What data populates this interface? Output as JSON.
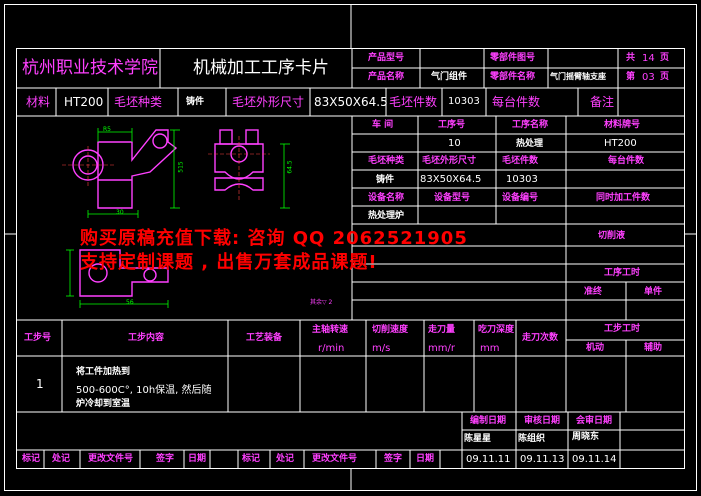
{
  "header": {
    "school": "杭州职业技术学院",
    "card_title": "机械加工工序卡片",
    "product_model_label": "产品型号",
    "product_name_label": "产品名称",
    "product_name": "气门组件",
    "part_model_label": "零部件图号",
    "part_name_label": "零部件名称",
    "part_name": "气门摇臂轴支座",
    "total_label": "共",
    "total_pages": "14",
    "page_unit": "页",
    "sheet_label": "第",
    "sheet_no": "03",
    "sheet_unit": "页"
  },
  "material_row": {
    "material_label": "材料",
    "material": "HT200",
    "blank_type_label": "毛坯种类",
    "blank_type": "铸件",
    "blank_size_label": "毛坯外形尺寸",
    "blank_size": "83X50X64.5",
    "blank_count_label": "毛坯件数",
    "blank_count": "10303",
    "per_piece_label": "每台件数",
    "remark_label": "备注"
  },
  "info_table": {
    "workshop_label": "车 间",
    "op_no_label": "工序号",
    "op_name_label": "工序名称",
    "material_no_label": "材料牌号",
    "op_no": "10",
    "op_name": "热处理",
    "material_no": "HT200",
    "blank_type_label": "毛坯种类",
    "blank_size_label": "毛坯外形尺寸",
    "blank_pieces_label": "毛坯件数",
    "per_unit_label": "每台件数",
    "blank_type": "铸件",
    "blank_size": "83X50X64.5",
    "blank_pieces": "10303",
    "equip_name_label": "设备名称",
    "equip_model_label": "设备型号",
    "equip_no_label": "设备编号",
    "concurrent_label": "同时加工件数",
    "equip_name": "热处理炉",
    "coolant_label": "切削液",
    "op_hours_label": "工序工时",
    "prep_label": "准终",
    "unit_label": "单件"
  },
  "drawing": {
    "dim_width": "30",
    "dim_bottom": "56",
    "dim_height_left": "515",
    "dim_height_right": "64.5",
    "dim_top": "R5",
    "scale_note": "其余▽ 2"
  },
  "steps_table": {
    "headers": [
      "工步号",
      "工步内容",
      "工艺装备",
      "主轴转速",
      "切削速度",
      "走刀量",
      "吃刀深度",
      "走刀次数",
      "工步工时"
    ],
    "units": [
      "r/min",
      "m/s",
      "mm/r",
      "mm"
    ],
    "time_sub": [
      "机动",
      "辅助"
    ],
    "rows": [
      {
        "no": "1",
        "line1": "将工件加热到",
        "line2": "500-600C°, 10h保温, 然后随",
        "line3": "炉冷却到室温"
      }
    ]
  },
  "footer": {
    "compile_label": "编制日期",
    "review_label": "审核日期",
    "approve_label": "会审日期",
    "compiler": "陈星星",
    "reviewer": "陈组织",
    "approver": "周晓东",
    "compile_date": "09.11.11",
    "review_date": "09.11.13",
    "approve_date": "09.11.14",
    "mark_labels": [
      "标记",
      "处记",
      "更改文件号",
      "签字",
      "日期",
      "标记",
      "处记",
      "更改文件号",
      "签字",
      "日期"
    ]
  },
  "watermark": {
    "line1": "购买原稿充值下载: 咨询 QQ 2062521905",
    "line2": "支持定制课题 , 出售万套成品课题!"
  }
}
